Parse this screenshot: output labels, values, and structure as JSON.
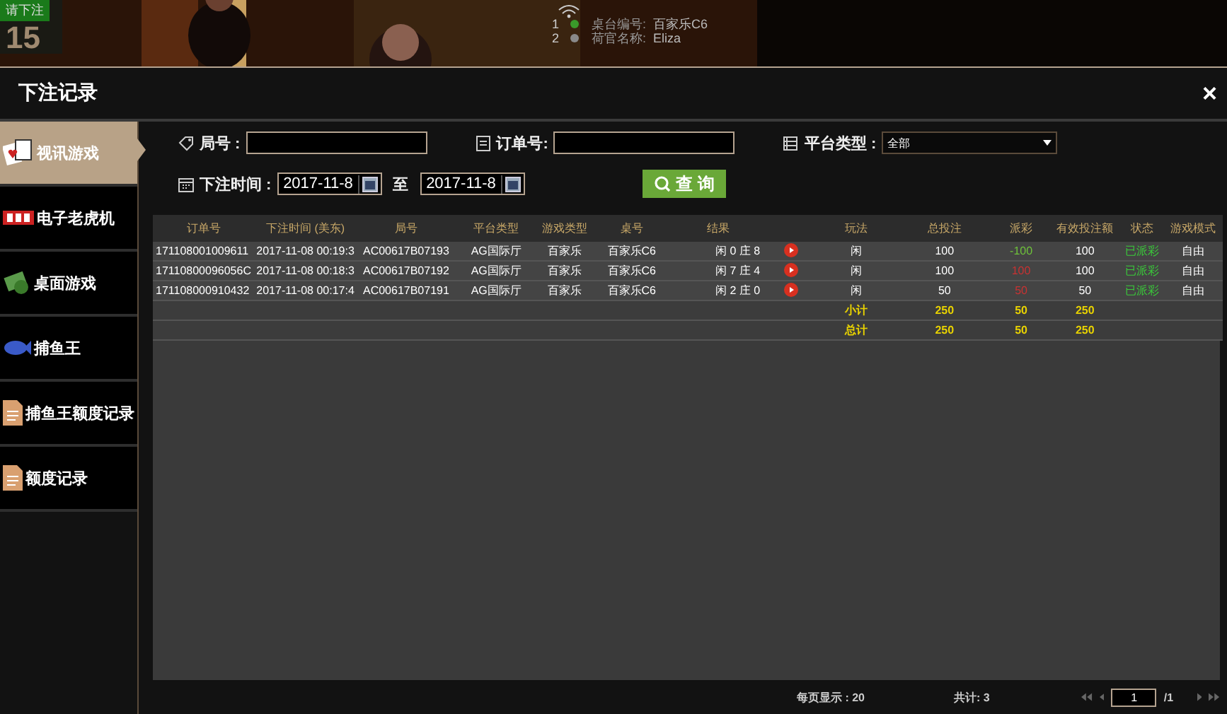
{
  "video": {
    "kind": "picture",
    "countdown_label": "请下注",
    "countdown": "15",
    "info": [
      {
        "index": "1",
        "label": "桌台编号:",
        "value": "百家乐C6",
        "color": "#3a9a2a"
      },
      {
        "index": "2",
        "label": "荷官名称:",
        "value": "Eliza",
        "color": "#8a8a8a"
      }
    ]
  },
  "dialog": {
    "title": "下注记录",
    "close": "×"
  },
  "sidebar": {
    "items": [
      {
        "label": "视讯游戏",
        "kind": "cards",
        "selected": true
      },
      {
        "label": "电子老虎机",
        "kind": "slot",
        "selected": false
      },
      {
        "label": "桌面游戏",
        "kind": "cash",
        "selected": false
      },
      {
        "label": "捕鱼王",
        "kind": "fish",
        "selected": false
      },
      {
        "label": "捕鱼王额度记录",
        "kind": "doc",
        "selected": false
      },
      {
        "label": "额度记录",
        "kind": "doc",
        "selected": false
      }
    ]
  },
  "filters": {
    "round_label": "局号 :",
    "order_label": "订单号:",
    "platform_label": "平台类型 :",
    "platform_value": "全部",
    "time_label": "下注时间 :",
    "date_from": "2017-11-8",
    "to_label": "至",
    "date_to": "2017-11-8",
    "query_button": "查 询"
  },
  "table": {
    "columns": [
      "订单号",
      "下注时间 (美东)",
      "局号",
      "平台类型",
      "游戏类型",
      "桌号",
      "结果",
      "",
      "玩法",
      "总投注",
      "派彩",
      "有效投注额",
      "状态",
      "游戏模式"
    ],
    "rows": [
      {
        "order": "171108001009611",
        "time": "2017-11-08 00:19:3",
        "round": "AC00617B07193",
        "platform": "AG国际厅",
        "game": "百家乐",
        "table": "百家乐C6",
        "result": "闲 0 庄 8",
        "play": "闲",
        "bet": "100",
        "payout": "-100",
        "color": "#6ec23a",
        "valid": "100",
        "status": "已派彩",
        "mode": "自由"
      },
      {
        "order": "17110800096056C",
        "time": "2017-11-08 00:18:3",
        "round": "AC00617B07192",
        "platform": "AG国际厅",
        "game": "百家乐",
        "table": "百家乐C6",
        "result": "闲 7 庄 4",
        "play": "闲",
        "bet": "100",
        "payout": "100",
        "color": "#c83232",
        "valid": "100",
        "status": "已派彩",
        "mode": "自由"
      },
      {
        "order": "171108000910432",
        "time": "2017-11-08 00:17:4",
        "round": "AC00617B07191",
        "platform": "AG国际厅",
        "game": "百家乐",
        "table": "百家乐C6",
        "result": "闲 2 庄 0",
        "play": "闲",
        "bet": "50",
        "payout": "50",
        "color": "#c83232",
        "valid": "50",
        "status": "已派彩",
        "mode": "自由"
      }
    ],
    "totals": [
      {
        "label": "小计",
        "bet": "250",
        "payout": "50",
        "valid": "250"
      },
      {
        "label": "总计",
        "bet": "250",
        "payout": "50",
        "valid": "250"
      }
    ]
  },
  "footer": {
    "per_page": "每页显示 : 20",
    "total": "共计: 3",
    "page": "1",
    "pages": "/1"
  }
}
